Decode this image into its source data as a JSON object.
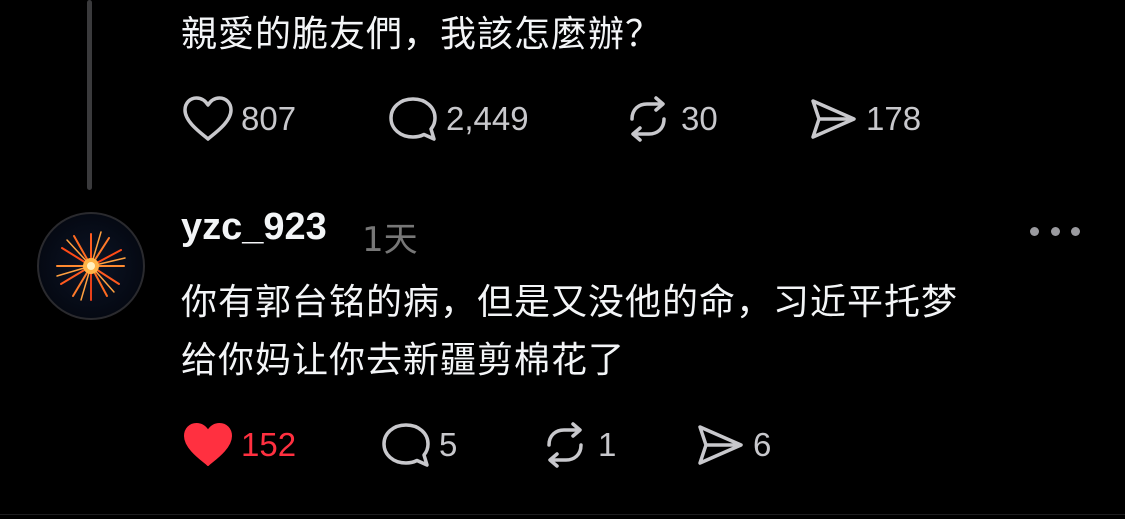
{
  "original_post": {
    "text": "親愛的脆友們，我該怎麼辦？",
    "actions": {
      "like_count": "807",
      "comment_count": "2,449",
      "repost_count": "30",
      "share_count": "178"
    }
  },
  "reply": {
    "username": "yzc_923",
    "timestamp": "1天",
    "text_line1": "你有郭台铭的病，但是又没他的命，习近平托梦",
    "text_line2": "给你妈让你去新疆剪棉花了",
    "liked": true,
    "actions": {
      "like_count": "152",
      "comment_count": "5",
      "repost_count": "1",
      "share_count": "6"
    }
  },
  "icons": {
    "like": "heart-icon",
    "comment": "comment-bubble-icon",
    "repost": "repost-icon",
    "share": "send-icon",
    "more": "more-dots-icon"
  },
  "colors": {
    "background": "#000000",
    "text": "#f3f5f7",
    "muted": "#777777",
    "liked": "#ff3040"
  }
}
